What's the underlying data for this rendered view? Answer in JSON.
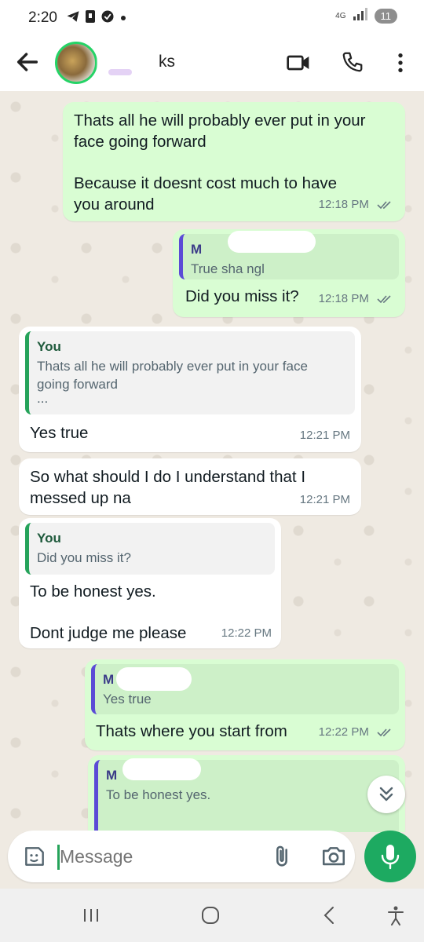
{
  "status_bar": {
    "time": "2:20",
    "network": "4G",
    "battery": "11"
  },
  "header": {
    "contact_name_visible": "ks"
  },
  "messages": [
    {
      "direction": "outgoing",
      "text_line1": "Thats all he will probably ever put in your",
      "text_line2": "face going forward",
      "text_line3": "Because it doesnt cost much to have",
      "text_line4": "you around",
      "time": "12:18 PM"
    },
    {
      "direction": "outgoing",
      "quote_name": "M",
      "quote_text": "True sha ngl",
      "text": "Did you miss it?",
      "time": "12:18 PM"
    },
    {
      "direction": "incoming",
      "quote_name": "You",
      "quote_text_line1": "Thats all he will probably ever put in your face",
      "quote_text_line2": "going forward",
      "quote_more": "...",
      "text": "Yes true",
      "time": "12:21 PM"
    },
    {
      "direction": "incoming",
      "text_line1": "So what should I do I understand that I",
      "text_line2": "messed up na",
      "time": "12:21 PM"
    },
    {
      "direction": "incoming",
      "quote_name": "You",
      "quote_text": "Did you miss it?",
      "text_line1": "To be honest yes.",
      "text_line2": "Dont judge me please",
      "time": "12:22 PM"
    },
    {
      "direction": "outgoing",
      "quote_name": "M",
      "quote_text": "Yes true",
      "text": "Thats where you start from",
      "time": "12:22 PM"
    },
    {
      "direction": "outgoing",
      "quote_name": "M",
      "quote_text": "To be honest yes."
    }
  ],
  "input": {
    "placeholder": "Message"
  },
  "icons": {
    "back": "arrow-left-icon",
    "video": "video-camera-icon",
    "call": "phone-icon",
    "menu": "more-vert-icon",
    "emoji": "sticker-icon",
    "attach": "paperclip-icon",
    "camera": "camera-icon",
    "mic": "microphone-icon",
    "scroll": "double-chevron-down-icon"
  },
  "colors": {
    "outgoing_bubble": "#d9fdd3",
    "incoming_bubble": "#ffffff",
    "accent_green": "#1daa61",
    "chat_background": "#efeae2"
  }
}
